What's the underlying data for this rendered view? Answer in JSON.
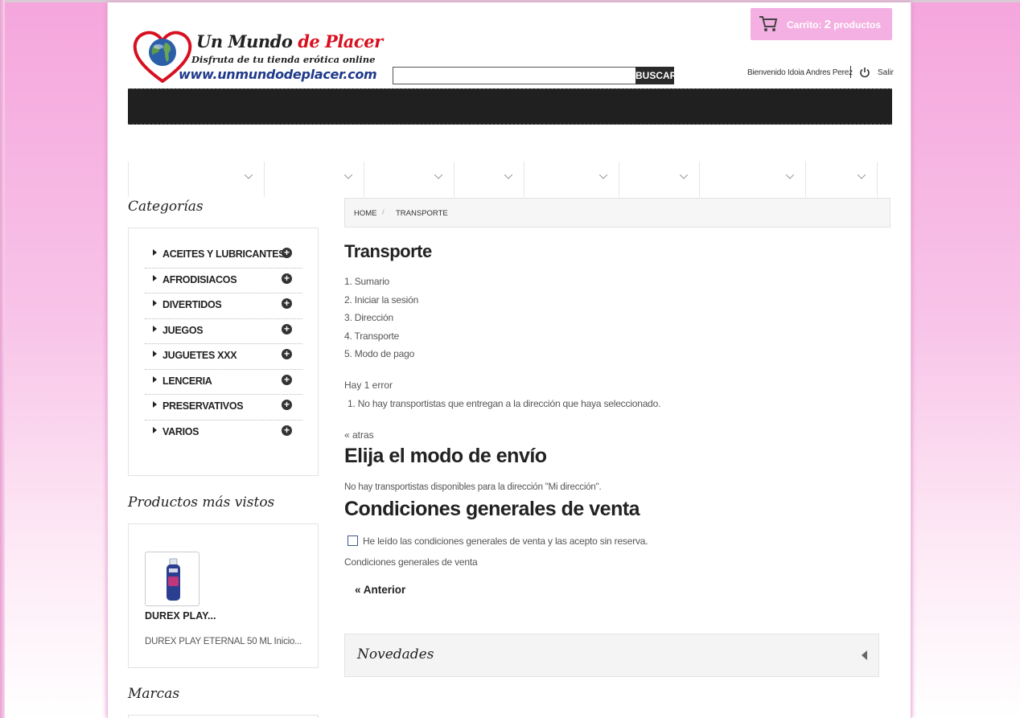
{
  "header": {
    "logo_line1_a": "Un Mundo ",
    "logo_line1_b": "de Placer",
    "logo_line2": "Disfruta de tu tienda erótica online",
    "logo_line3": "www.unmundodeplacer.com",
    "search_button": "BUSCAR",
    "search_value": "",
    "cart_label": "Carrito: ",
    "cart_count": "2",
    "cart_suffix": " productos",
    "welcome": "Bienvenido Idoia Andres Perez",
    "logout": "Salir"
  },
  "sidebar": {
    "categories_title": "Categorías",
    "categories": [
      {
        "label": "ACEITES Y LUBRICANTES"
      },
      {
        "label": "AFRODISIACOS"
      },
      {
        "label": "DIVERTIDOS"
      },
      {
        "label": "JUEGOS"
      },
      {
        "label": "JUGUETES XXX"
      },
      {
        "label": "LENCERIA"
      },
      {
        "label": "PRESERVATIVOS"
      },
      {
        "label": "VARIOS"
      }
    ],
    "viewed_title": "Productos más vistos",
    "viewed_product": {
      "name": "DUREX PLAY...",
      "desc": "DUREX PLAY ETERNAL 50 ML Inicio..."
    },
    "brands_title": "Marcas"
  },
  "breadcrumb": {
    "home": "HOME",
    "sep": "/",
    "current": "TRANSPORTE"
  },
  "main": {
    "title": "Transporte",
    "steps": [
      "1. Sumario",
      "2. Iniciar la sesión",
      "3. Dirección",
      "4. Transporte",
      "5. Modo de pago"
    ],
    "error_head": "Hay 1 error",
    "error_item": "1.   No hay transportistas que entregan a la dirección que haya seleccionado.",
    "back_link": "« atras",
    "shipping_title": "Elija el modo de envío",
    "no_carrier": "No hay transportistas disponibles para la dirección \"Mi dirección\".",
    "conditions_title": "Condiciones generales de venta",
    "tos_label": "He leído las condiciones generales de venta y las acepto sin reserva.",
    "tos_link": "Condiciones generales de venta",
    "tos_checked": false,
    "prev_button": "« Anterior",
    "novedades_title": "Novedades"
  },
  "colors": {
    "accent_pink": "#f4b0e2",
    "nav_dark": "#202020"
  },
  "icons": [
    "cart-icon",
    "power-icon",
    "chevron-down-icon",
    "plus-icon",
    "caret-right-icon",
    "caret-left-icon"
  ]
}
